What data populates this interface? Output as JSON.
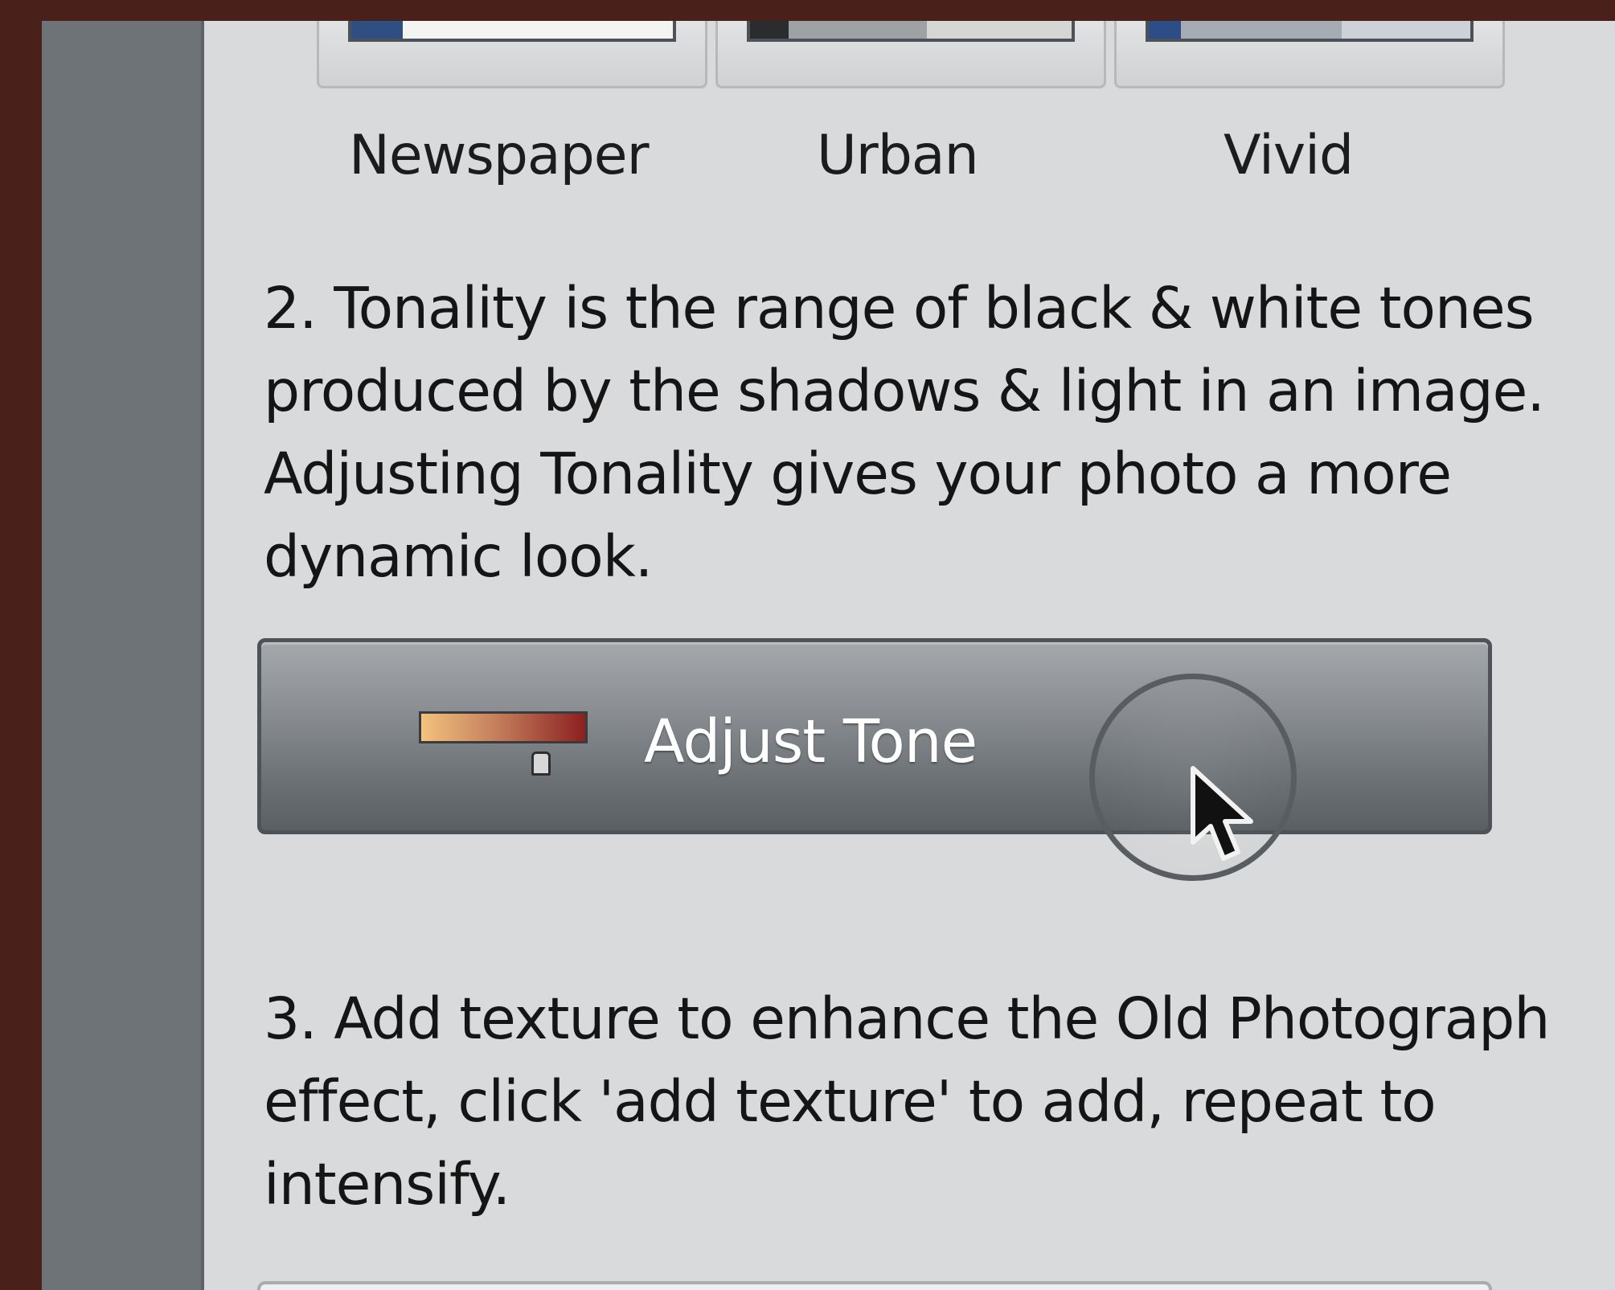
{
  "presets": {
    "items": [
      {
        "label": "Newspaper",
        "icon": "newspaper-thumbnail"
      },
      {
        "label": "Urban",
        "icon": "urban-thumbnail"
      },
      {
        "label": "Vivid",
        "icon": "vivid-thumbnail"
      }
    ]
  },
  "steps": {
    "step2": "2. Tonality is the range of black & white tones produced by the shadows & light in an image. Adjusting Tonality gives your photo a more dynamic look.",
    "step3": "3. Add texture to enhance the Old Photograph effect, click 'add texture' to add, repeat to intensify."
  },
  "adjust_tone_button": {
    "label": "Adjust Tone",
    "icon": "tone-gradient-icon"
  },
  "colors": {
    "background": "#4a201b",
    "panel": "#d8dadc",
    "sidebar": "#6e7377",
    "button": "#8b8f93",
    "gradient_start": "#f3c27e",
    "gradient_end": "#8c2020"
  }
}
